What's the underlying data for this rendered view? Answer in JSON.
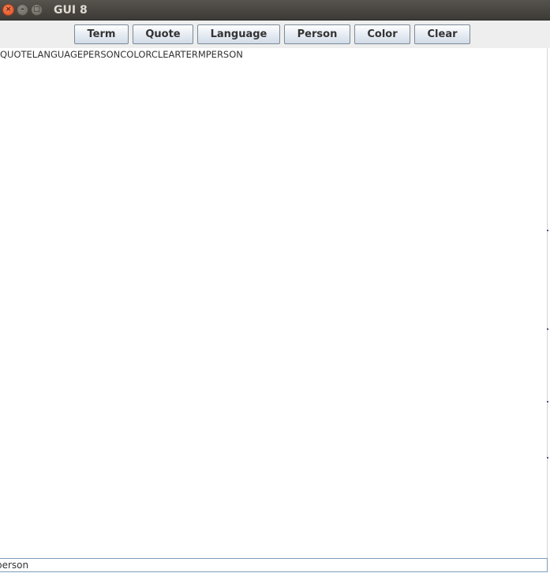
{
  "window": {
    "title": "GUI 8",
    "controls": {
      "close": "×",
      "minimize": "–",
      "maximize": "□"
    }
  },
  "toolbar": {
    "buttons": [
      {
        "id": "term",
        "label": "Term"
      },
      {
        "id": "quote",
        "label": "Quote"
      },
      {
        "id": "language",
        "label": "Language"
      },
      {
        "id": "person",
        "label": "Person"
      },
      {
        "id": "color",
        "label": "Color"
      },
      {
        "id": "clear",
        "label": "Clear"
      }
    ]
  },
  "output": {
    "text": "QUOTELANGUAGEPERSONCOLORCLEARTERMPERSON"
  },
  "input": {
    "value": "person"
  }
}
